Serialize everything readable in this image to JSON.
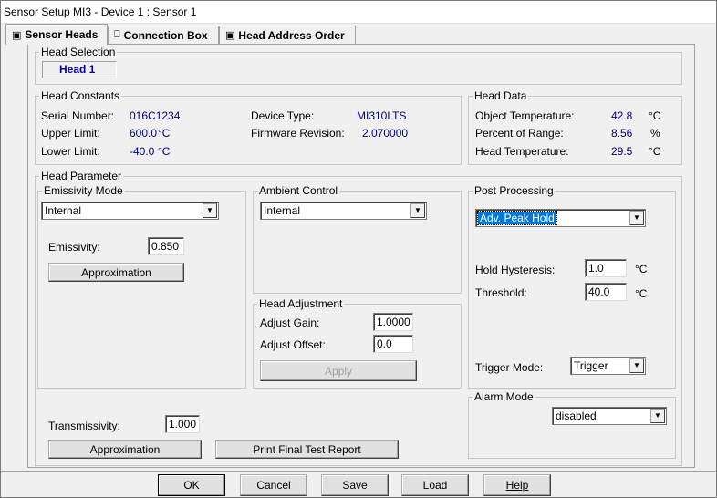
{
  "window": {
    "title": "Sensor Setup MI3 - Device 1 : Sensor 1"
  },
  "tabs": [
    {
      "label": "Sensor Heads",
      "icon": "sensor-head-icon"
    },
    {
      "label": "Connection Box",
      "icon": "connection-box-icon"
    },
    {
      "label": "Head Address Order",
      "icon": "head-address-icon"
    }
  ],
  "head_selection": {
    "label": "Head Selection",
    "value": "Head 1"
  },
  "head_constants": {
    "label": "Head Constants",
    "serial_label": "Serial Number:",
    "serial_value": "016C1234",
    "upper_label": "Upper Limit:",
    "upper_value": "600.0",
    "upper_unit": "°C",
    "lower_label": "Lower Limit:",
    "lower_value": "-40.0",
    "lower_unit": "°C",
    "device_type_label": "Device Type:",
    "device_type_value": "MI310LTS",
    "firmware_label": "Firmware Revision:",
    "firmware_value": "2.070000"
  },
  "head_data": {
    "label": "Head Data",
    "object_temp_label": "Object Temperature:",
    "object_temp_value": "42.8",
    "object_temp_unit": "°C",
    "percent_range_label": "Percent of Range:",
    "percent_range_value": "8.56",
    "percent_range_unit": "%",
    "head_temp_label": "Head Temperature:",
    "head_temp_value": "29.5",
    "head_temp_unit": "°C"
  },
  "head_parameter": {
    "label": "Head Parameter",
    "emissivity_mode": {
      "label": "Emissivity Mode",
      "selected": "Internal",
      "emissivity_label": "Emissivity:",
      "emissivity_value": "0.850",
      "approx_button": "Approximation"
    },
    "ambient_control": {
      "label": "Ambient Control",
      "selected": "Internal"
    },
    "head_adjustment": {
      "label": "Head Adjustment",
      "gain_label": "Adjust Gain:",
      "gain_value": "1.0000",
      "offset_label": "Adjust Offset:",
      "offset_value": "0.0",
      "apply_button": "Apply"
    },
    "transmissivity_label": "Transmissivity:",
    "transmissivity_value": "1.000",
    "approx_button_2": "Approximation",
    "print_button": "Print Final Test Report",
    "post_processing": {
      "label": "Post Processing",
      "selected": "Adv. Peak Hold",
      "hysteresis_label": "Hold Hysteresis:",
      "hysteresis_value": "1.0",
      "hysteresis_unit": "°C",
      "threshold_label": "Threshold:",
      "threshold_value": "40.0",
      "threshold_unit": "°C",
      "trigger_label": "Trigger Mode:",
      "trigger_selected": "Trigger"
    },
    "alarm_mode": {
      "label": "Alarm Mode",
      "selected": "disabled"
    }
  },
  "footer": {
    "ok": "OK",
    "cancel": "Cancel",
    "save": "Save",
    "load": "Load",
    "help": "Help"
  }
}
